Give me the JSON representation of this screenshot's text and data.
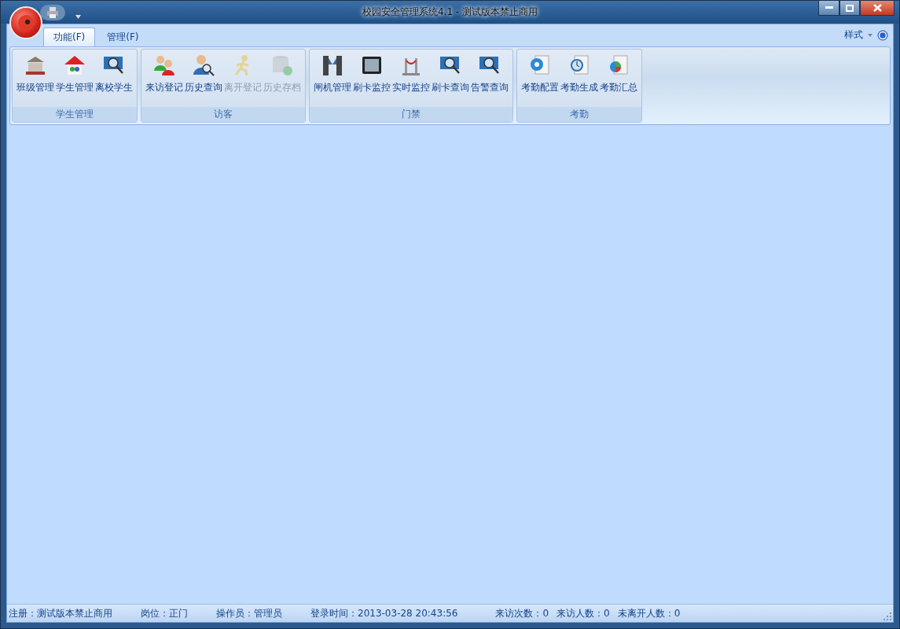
{
  "window": {
    "title": "校园安全管理系统4.1 - 测试版本禁止商用"
  },
  "tabs": [
    {
      "label": "功能(F)",
      "selected": true
    },
    {
      "label": "管理(F)",
      "selected": false
    }
  ],
  "style_menu": {
    "label": "样式"
  },
  "ribbon_groups": [
    {
      "title": "学生管理",
      "buttons": [
        {
          "label": "班级管理",
          "disabled": false
        },
        {
          "label": "学生管理",
          "disabled": false
        },
        {
          "label": "离校学生",
          "disabled": false
        }
      ]
    },
    {
      "title": "访客",
      "buttons": [
        {
          "label": "来访登记",
          "disabled": false
        },
        {
          "label": "历史查询",
          "disabled": false
        },
        {
          "label": "离开登记",
          "disabled": true
        },
        {
          "label": "历史存档",
          "disabled": true
        }
      ]
    },
    {
      "title": "门禁",
      "buttons": [
        {
          "label": "闸机管理",
          "disabled": false
        },
        {
          "label": "刷卡监控",
          "disabled": false
        },
        {
          "label": "实时监控",
          "disabled": false
        },
        {
          "label": "刷卡查询",
          "disabled": false
        },
        {
          "label": "告警查询",
          "disabled": false
        }
      ]
    },
    {
      "title": "考勤",
      "buttons": [
        {
          "label": "考勤配置",
          "disabled": false
        },
        {
          "label": "考勤生成",
          "disabled": false
        },
        {
          "label": "考勤汇总",
          "disabled": false
        }
      ]
    }
  ],
  "status_bar": {
    "info": [
      "注册：测试版本禁止商用",
      "岗位：正门",
      "操作员：管理员",
      "登录时间：2013-03-28 20:43:56"
    ],
    "counts": [
      "来访次数：0",
      "来访人数：0",
      "未离开人数：0"
    ]
  }
}
